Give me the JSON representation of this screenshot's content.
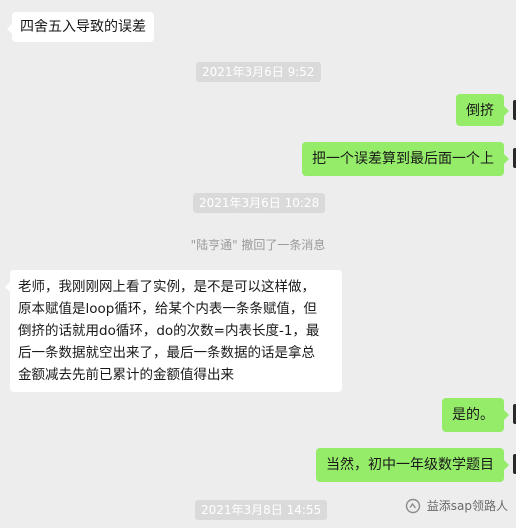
{
  "messages": [
    {
      "type": "incoming",
      "text": "四舍五入导致的误差"
    },
    {
      "type": "time",
      "text": "2021年3月6日 9:52"
    },
    {
      "type": "outgoing",
      "text": "倒挤"
    },
    {
      "type": "outgoing",
      "text": "把一个误差算到最后面一个上"
    },
    {
      "type": "time",
      "text": "2021年3月6日 10:28"
    },
    {
      "type": "system",
      "text": "\"陆亨通\" 撤回了一条消息"
    },
    {
      "type": "incoming",
      "lines": [
        "老师，我刚刚网上看了实例，是不是可以这样做，",
        "原本赋值是loop循环，给某个内表一条条赋值，但",
        "倒挤的话就用do循环，do的次数=内表长度-1，最",
        "后一条数据就空出来了，最后一条数据的话是拿总",
        "金额减去先前已累计的金额值得出来"
      ]
    },
    {
      "type": "outgoing",
      "text": "是的。"
    },
    {
      "type": "outgoing",
      "text": "当然，初中一年级数学题目"
    },
    {
      "type": "time",
      "text": "2021年3月8日 14:55"
    }
  ],
  "watermark": {
    "icon": "wechat-official-account-icon",
    "text": "益添sap领路人"
  },
  "colors": {
    "background": "#ededed",
    "outgoing_bubble": "#95ec69",
    "incoming_bubble": "#ffffff",
    "time_badge": "#dadada"
  }
}
